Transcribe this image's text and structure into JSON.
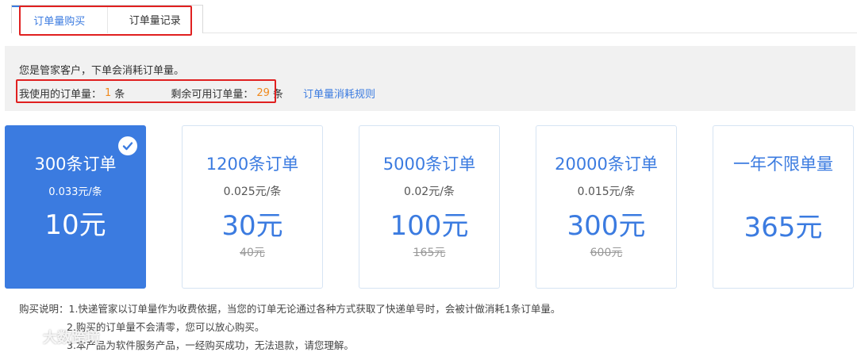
{
  "tabs": [
    {
      "label": "订单量购买",
      "active": true
    },
    {
      "label": "订单量记录",
      "active": false
    }
  ],
  "info": {
    "line1": "您是管家客户，下单会消耗订单量。",
    "used_label": "我使用的订单量：",
    "used_value": "1",
    "used_unit": "条",
    "remaining_label": "剩余可用订单量：",
    "remaining_value": "29",
    "remaining_unit": "条",
    "rule_link": "订单量消耗规则"
  },
  "cards": [
    {
      "title": "300条订单",
      "unit_price": "0.033元/条",
      "price": "10元",
      "old_price": "",
      "selected": true
    },
    {
      "title": "1200条订单",
      "unit_price": "0.025元/条",
      "price": "30元",
      "old_price": "40元",
      "selected": false
    },
    {
      "title": "5000条订单",
      "unit_price": "0.02元/条",
      "price": "100元",
      "old_price": "165元",
      "selected": false
    },
    {
      "title": "20000条订单",
      "unit_price": "0.015元/条",
      "price": "300元",
      "old_price": "600元",
      "selected": false
    },
    {
      "title": "一年不限单量",
      "unit_price": "",
      "price": "365元",
      "old_price": "",
      "selected": false
    }
  ],
  "notes": {
    "line1": "购买说明：1.快递管家以订单量作为收费依据，当您的订单无论通过各种方式获取了快递单号时，会被计做消耗1条订单量。",
    "line2": "2.购买的订单量不会清零，您可以放心购买。",
    "line3": "3.本产品为软件服务产品，一经购买成功，无法退款，请您理解。"
  },
  "watermark": {
    "text": "大数跨境",
    "icon": "logo-icon"
  },
  "colors": {
    "accent": "#3b7be0",
    "highlight": "#f08a1e",
    "annotation": "#e02020"
  }
}
